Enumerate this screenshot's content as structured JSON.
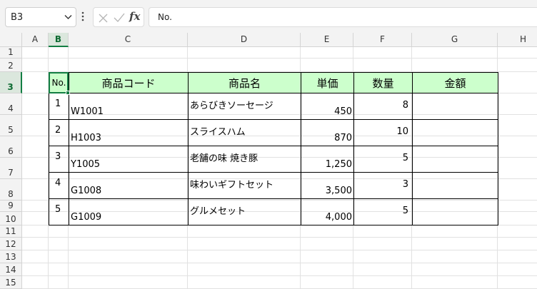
{
  "formula_bar": {
    "name_box": "B3",
    "formula_icon": "fx",
    "content": "No."
  },
  "columns": [
    "A",
    "B",
    "C",
    "D",
    "E",
    "F",
    "G",
    "H"
  ],
  "rows": [
    "1",
    "2",
    "3",
    "4",
    "5",
    "6",
    "7",
    "8",
    "9",
    "10",
    "11",
    "12",
    "13",
    "14",
    "15"
  ],
  "table": {
    "headers": [
      "No.",
      "商品コード",
      "商品名",
      "単価",
      "数量",
      "金額"
    ],
    "rows": [
      {
        "no": "1",
        "code": "W1001",
        "name": "あらびきソーセージ",
        "price": "450",
        "qty": "8",
        "amount": ""
      },
      {
        "no": "2",
        "code": "H1003",
        "name": "スライスハム",
        "price": "870",
        "qty": "10",
        "amount": ""
      },
      {
        "no": "3",
        "code": "Y1005",
        "name": "老舗の味 焼き豚",
        "price": "1,250",
        "qty": "5",
        "amount": ""
      },
      {
        "no": "4",
        "code": "G1008",
        "name": "味わいギフトセット",
        "price": "3,500",
        "qty": "3",
        "amount": ""
      },
      {
        "no": "5",
        "code": "G1009",
        "name": "グルメセット",
        "price": "4,000",
        "qty": "5",
        "amount": ""
      }
    ]
  },
  "colors": {
    "header_fill": "#ccffcc",
    "selection": "#137e43"
  }
}
